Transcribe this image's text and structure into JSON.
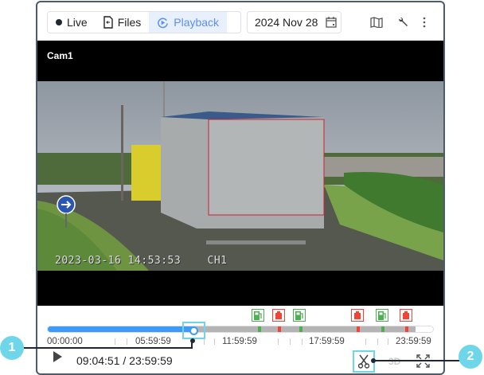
{
  "header": {
    "tabs": [
      {
        "label": "Live",
        "icon": "dot-icon"
      },
      {
        "label": "Files",
        "icon": "file-icon"
      },
      {
        "label": "Playback",
        "icon": "playback-icon",
        "active": true
      }
    ],
    "date": "2024 Nov 28",
    "icons": [
      "calendar-icon",
      "map-icon",
      "wrench-icon",
      "more-vertical-icon"
    ]
  },
  "video": {
    "camera": "Cam1",
    "osd_timestamp": "2023-03-16 14:53:53",
    "osd_channel": "CH1"
  },
  "timeline": {
    "ticks": [
      "00:00:00",
      "05:59:59",
      "11:59:59",
      "17:59:59",
      "23:59:59"
    ],
    "progress_percent": 37.8,
    "recorded_until_percent": 95.5,
    "events": [
      {
        "type": "fuel-fill",
        "color": "#4caf50",
        "percent": 54.5
      },
      {
        "type": "fuel-drain",
        "color": "#f44336",
        "percent": 59.8
      },
      {
        "type": "fuel-fill",
        "color": "#4caf50",
        "percent": 65.2
      },
      {
        "type": "fuel-drain",
        "color": "#f44336",
        "percent": 80.2
      },
      {
        "type": "fuel-fill",
        "color": "#4caf50",
        "percent": 86.6
      },
      {
        "type": "fuel-drain",
        "color": "#f44336",
        "percent": 92.8
      }
    ]
  },
  "controls": {
    "time": "09:04:51 / 23:59:59",
    "mode_3d": "3D",
    "icons": [
      "play-icon",
      "scissors-icon",
      "fullscreen-icon"
    ]
  },
  "callouts": [
    "1",
    "2"
  ],
  "colors": {
    "accent": "#3d9bf7",
    "callout": "#6fd6ea",
    "fill": "#4caf50",
    "drain": "#f44336"
  }
}
